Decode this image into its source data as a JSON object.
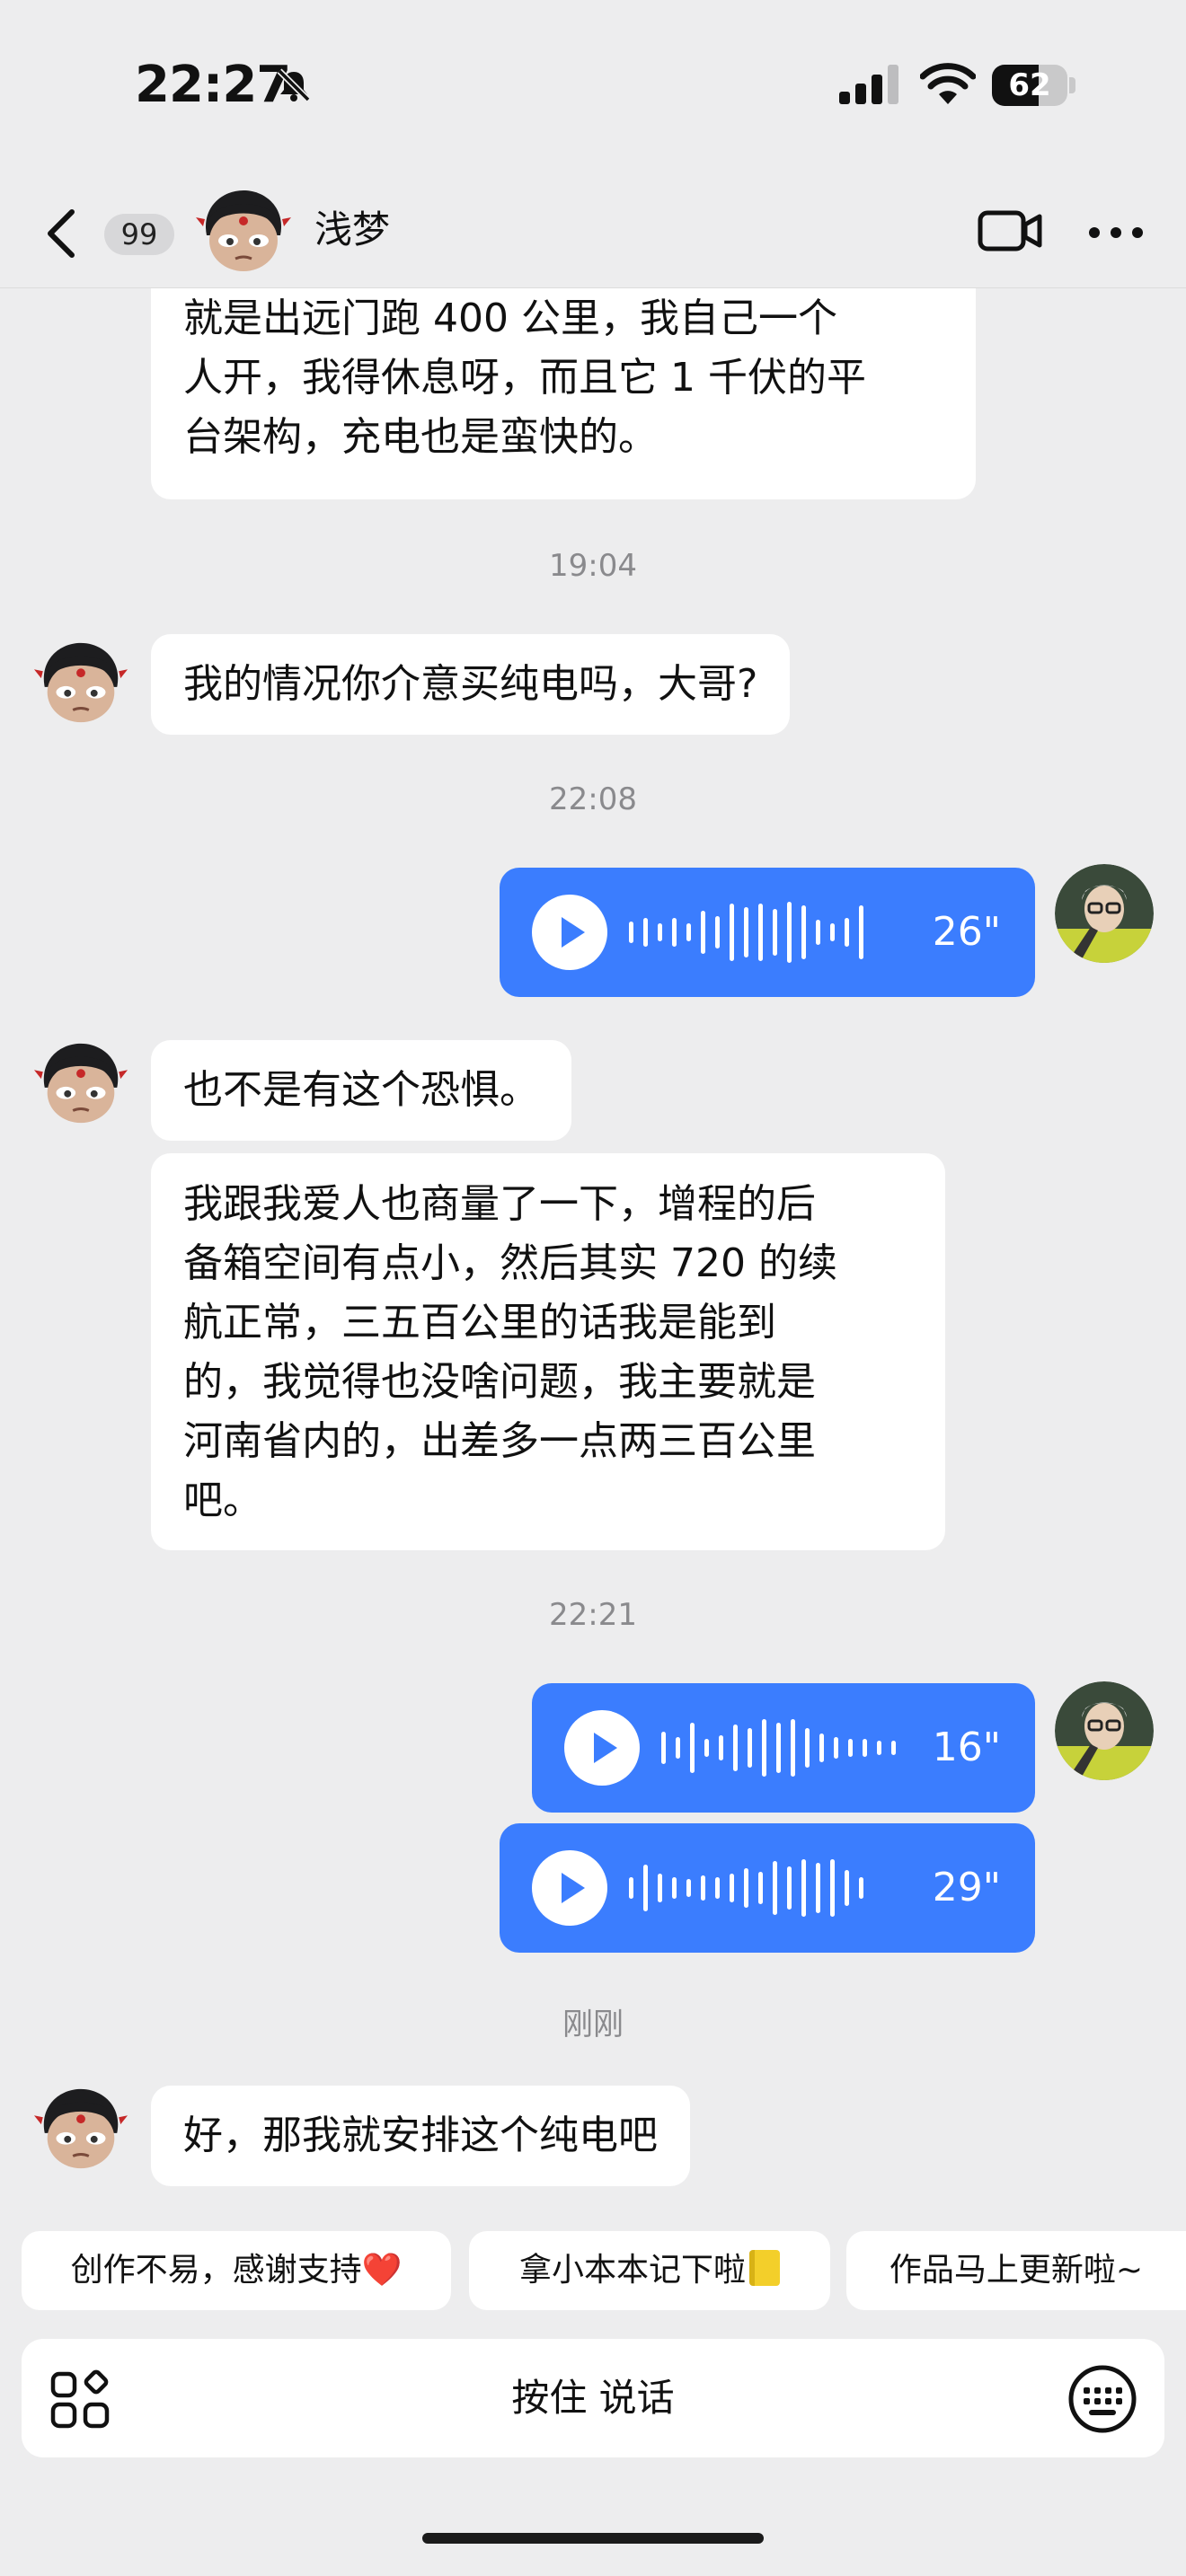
{
  "status_bar": {
    "time": "22:27",
    "battery": "62",
    "battery_level": 0.62
  },
  "header": {
    "back_badge": "99",
    "contact_name": "浅梦"
  },
  "messages": {
    "m1_partial": [
      "就是出远门跑 400 公里，我自己一个",
      "人开，我得休息呀，而且它 1 千伏的平",
      "台架构，充电也是蛮快的。"
    ],
    "ts1": "19:04",
    "m2": "我的情况你介意买纯电吗，大哥?",
    "ts2": "22:08",
    "voice1": "26\"",
    "m3": "也不是有这个恐惧。",
    "m4": [
      "我跟我爱人也商量了一下，增程的后",
      "备箱空间有点小，然后其实 720 的续",
      "航正常，三五百公里的话我是能到",
      "的，我觉得也没啥问题，我主要就是",
      "河南省内的，出差多一点两三百公里",
      "吧。"
    ],
    "ts3": "22:21",
    "voice2": "16\"",
    "voice3": "29\"",
    "ts4": "刚刚",
    "m5": "好，那我就安排这个纯电吧"
  },
  "quick_replies": {
    "q1": "创作不易，感谢支持",
    "q1_emoji": "❤️",
    "q2": "拿小本本记下啦",
    "q3": "作品马上更新啦~"
  },
  "input": {
    "hold_to_talk": "按住 说话"
  },
  "icons": {
    "silent": "bell-slash-icon",
    "signal": "signal-icon",
    "wifi": "wifi-icon",
    "back": "chevron-left-icon",
    "video": "video-camera-icon",
    "more": "more-dots-icon",
    "play": "play-icon",
    "apps": "apps-grid-icon",
    "keyboard": "keyboard-icon"
  },
  "colors": {
    "accent": "#3b7dfe",
    "background": "#ededee",
    "bubble": "#ffffff"
  }
}
